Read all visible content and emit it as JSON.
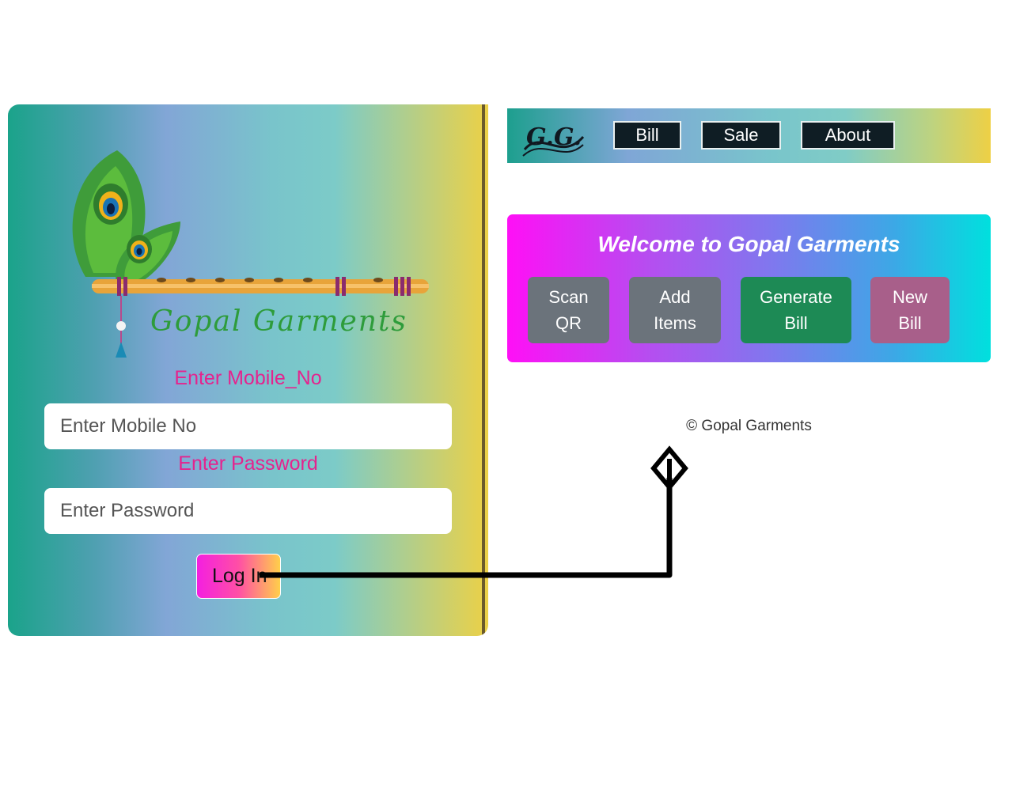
{
  "login": {
    "brand_name": "Gopal Garments",
    "mobile_label": "Enter Mobile_No",
    "mobile_placeholder": "Enter Mobile No",
    "password_label": "Enter Password",
    "password_placeholder": "Enter Password",
    "login_button": "Log In"
  },
  "navbar": {
    "logo_text": "G.G.",
    "buttons": [
      "Bill",
      "Sale",
      "About"
    ]
  },
  "welcome": {
    "title": "Welcome to Gopal Garments",
    "actions": [
      {
        "label": "Scan\nQR",
        "color": "#6b737b"
      },
      {
        "label": "Add\nItems",
        "color": "#6b737b"
      },
      {
        "label": "Generate\nBill",
        "color": "#1d8a55"
      },
      {
        "label": "New\nBill",
        "color": "#a85f8a"
      }
    ]
  },
  "footer": {
    "copyright": "© Gopal Garments"
  },
  "icons": [
    "peacock-feather-flute-icon",
    "gg-logo-icon",
    "arrow-icon"
  ]
}
